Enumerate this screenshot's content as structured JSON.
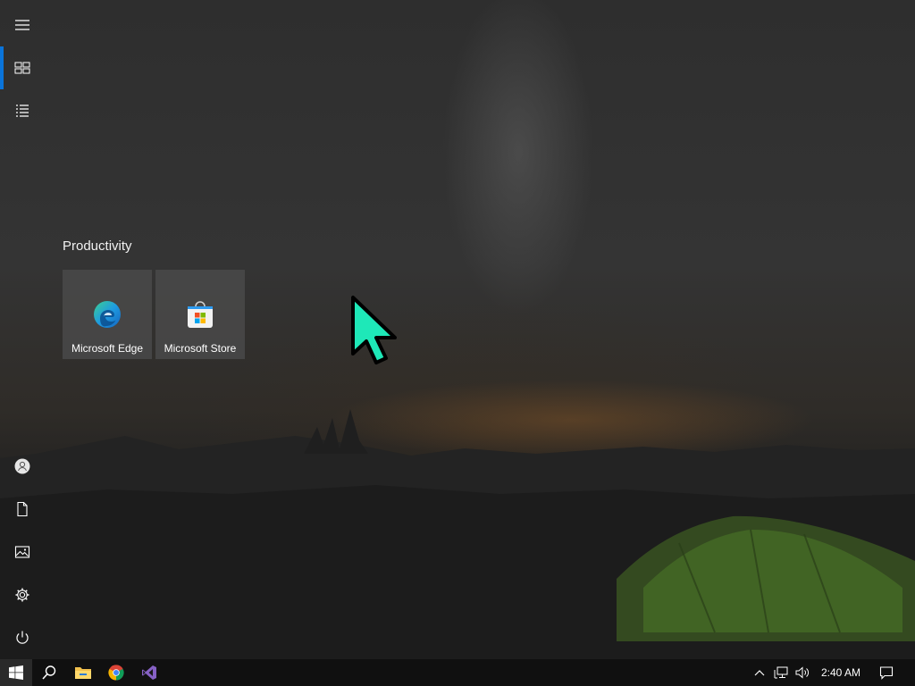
{
  "tiles_group": {
    "title": "Productivity",
    "tiles": [
      {
        "label": "Microsoft Edge",
        "icon": "edge-icon"
      },
      {
        "label": "Microsoft Store",
        "icon": "store-icon"
      }
    ]
  },
  "sidebar": {
    "items": [
      {
        "icon": "hamburger-menu-icon"
      },
      {
        "icon": "pinned-tiles-icon",
        "active": true
      },
      {
        "icon": "all-apps-list-icon"
      },
      {
        "icon": "user-account-icon"
      },
      {
        "icon": "documents-icon"
      },
      {
        "icon": "pictures-icon"
      },
      {
        "icon": "settings-icon"
      },
      {
        "icon": "power-icon"
      }
    ]
  },
  "taskbar": {
    "start_icon": "windows-start-icon",
    "pinned": [
      {
        "icon": "search-icon"
      },
      {
        "icon": "file-explorer-icon"
      },
      {
        "icon": "chrome-icon"
      },
      {
        "icon": "visual-studio-icon"
      }
    ],
    "tray": [
      {
        "icon": "show-hidden-icons-chevron-icon"
      },
      {
        "icon": "network-icon"
      },
      {
        "icon": "volume-icon"
      }
    ],
    "clock": "2:40 AM",
    "notification_icon": "action-center-icon"
  },
  "colors": {
    "accent": "#0a74da",
    "cursor": "#1ee8b8",
    "tile_bg": "#484848",
    "taskbar_bg": "#101010"
  }
}
